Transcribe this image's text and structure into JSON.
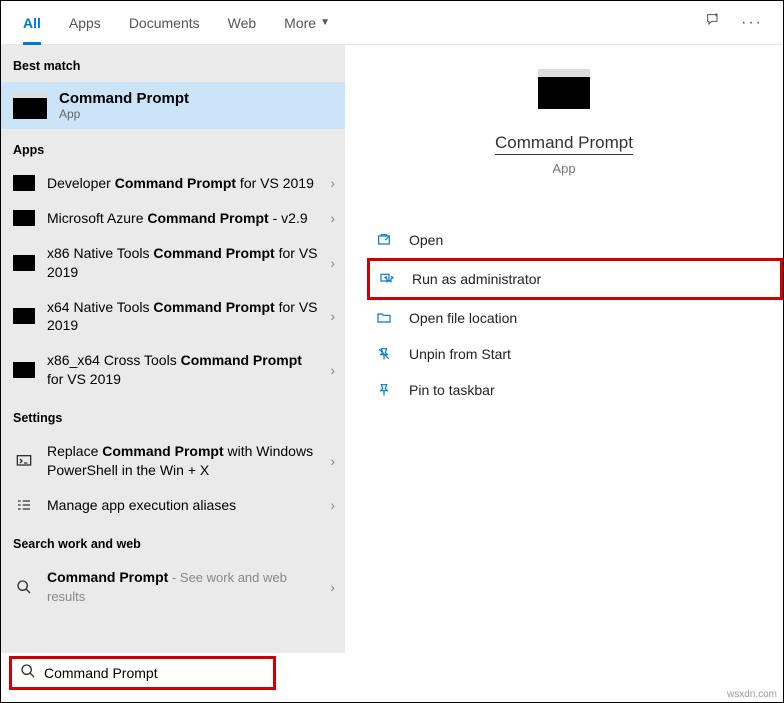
{
  "tabs": {
    "all": "All",
    "apps": "Apps",
    "documents": "Documents",
    "web": "Web",
    "more": "More"
  },
  "sections": {
    "best_match": "Best match",
    "apps": "Apps",
    "settings": "Settings",
    "search_web": "Search work and web"
  },
  "best_match": {
    "title": "Command Prompt",
    "subtitle": "App"
  },
  "apps_list": [
    {
      "pre": "Developer ",
      "bold": "Command Prompt",
      "post": " for VS 2019"
    },
    {
      "pre": "Microsoft Azure ",
      "bold": "Command Prompt",
      "post": " - v2.9"
    },
    {
      "pre": "x86 Native Tools ",
      "bold": "Command Prompt",
      "post": " for VS 2019"
    },
    {
      "pre": "x64 Native Tools ",
      "bold": "Command Prompt",
      "post": " for VS 2019"
    },
    {
      "pre": "x86_x64 Cross Tools ",
      "bold": "Command Prompt",
      "post": " for VS 2019"
    }
  ],
  "settings_list": [
    {
      "pre": "Replace ",
      "bold": "Command Prompt",
      "post": " with Windows PowerShell in the Win + X"
    },
    {
      "pre": "Manage app execution aliases",
      "bold": "",
      "post": ""
    }
  ],
  "web_list": [
    {
      "bold": "Command Prompt",
      "hint": " - See work and web results"
    }
  ],
  "preview": {
    "name": "Command Prompt",
    "type": "App"
  },
  "actions": {
    "open": "Open",
    "run_admin": "Run as administrator",
    "open_loc": "Open file location",
    "unpin": "Unpin from Start",
    "pin_taskbar": "Pin to taskbar"
  },
  "search": {
    "value": "Command Prompt"
  },
  "watermark": "wsxdn.com"
}
